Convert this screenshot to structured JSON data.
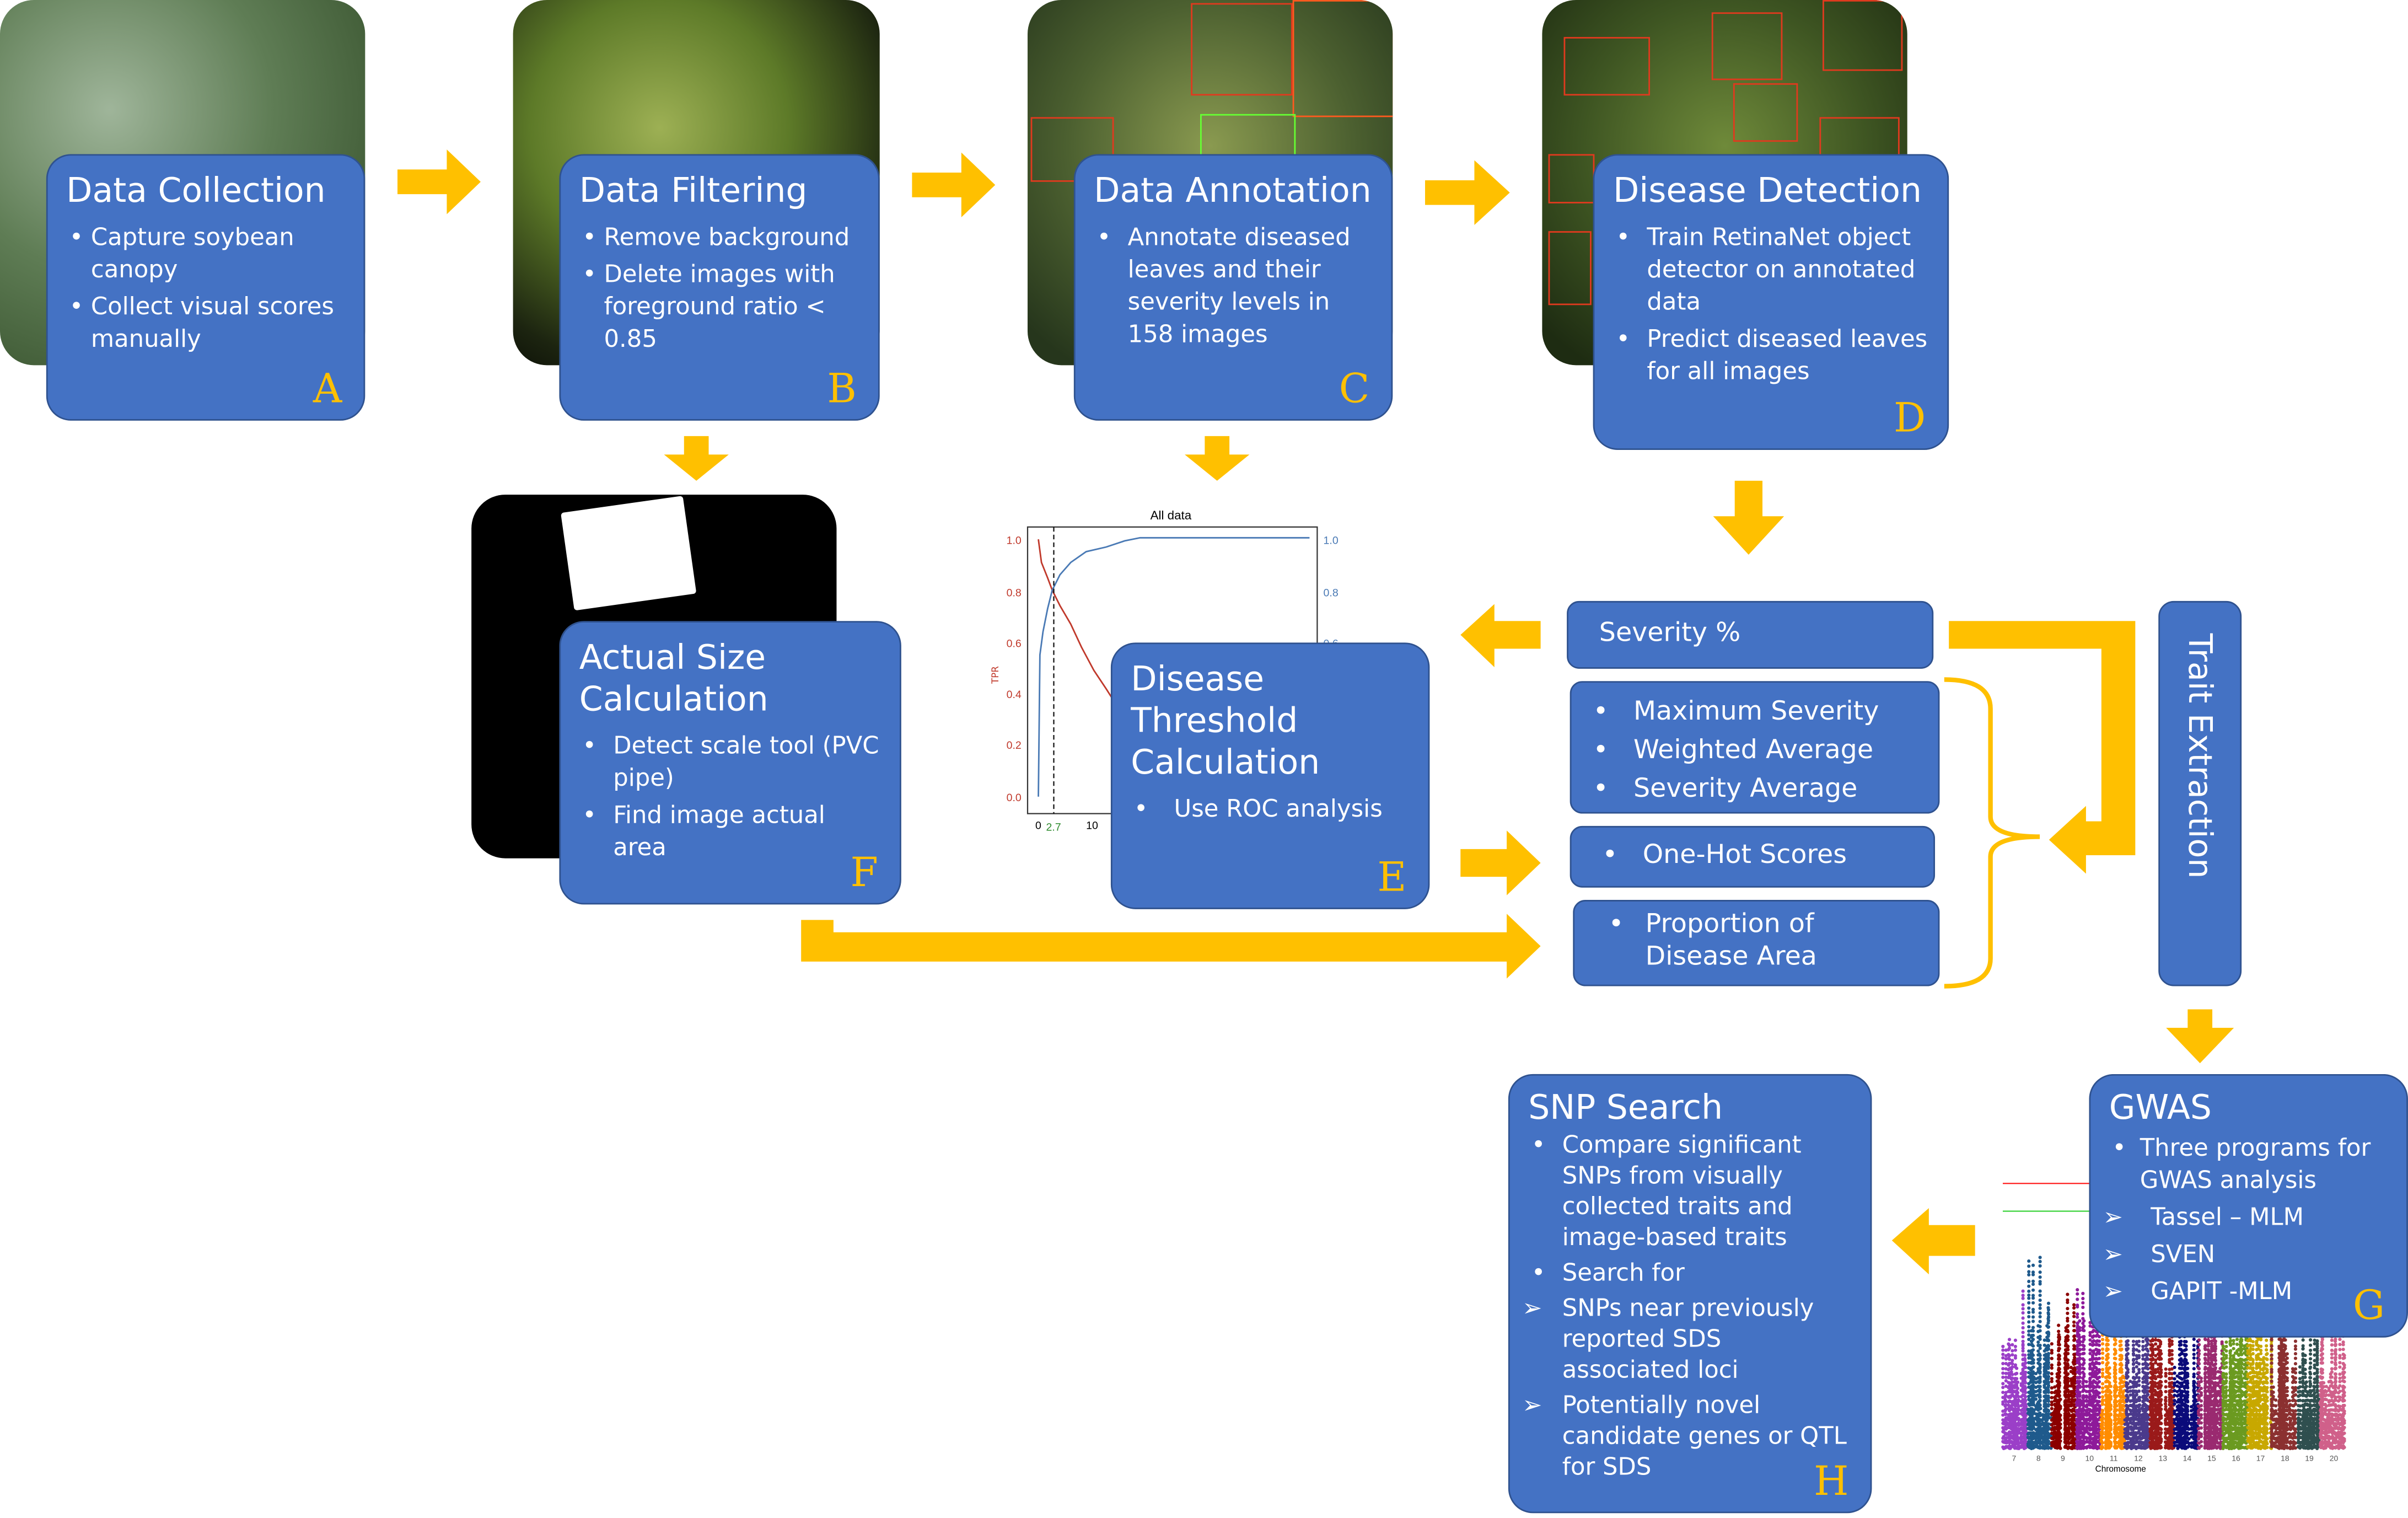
{
  "colors": {
    "box": "#4472c4",
    "arrow": "#ffc000",
    "letter": "#ffc000"
  },
  "steps": {
    "a": {
      "title": "Data Collection",
      "bullets": [
        "Capture soybean canopy",
        "Collect visual scores manually"
      ],
      "letter": "A"
    },
    "b": {
      "title": "Data Filtering",
      "bullets": [
        "Remove background",
        "Delete images with foreground ratio < 0.85"
      ],
      "letter": "B"
    },
    "c": {
      "title": "Data Annotation",
      "bullets": [
        "Annotate diseased leaves and their severity levels in 158 images"
      ],
      "letter": "C"
    },
    "d": {
      "title": "Disease Detection",
      "bullets": [
        "Train RetinaNet object detector on annotated data",
        "Predict diseased leaves for all images"
      ],
      "letter": "D"
    },
    "e": {
      "title": "Disease Threshold Calculation",
      "bullets": [
        "Use ROC analysis"
      ],
      "letter": "E"
    },
    "f": {
      "title": "Actual Size Calculation",
      "bullets": [
        "Detect scale tool (PVC pipe)",
        "Find image actual area"
      ],
      "letter": "F"
    },
    "g": {
      "title": "GWAS",
      "bullets": [
        "Three programs for GWAS analysis"
      ],
      "programs": [
        "Tassel – MLM",
        "SVEN",
        "GAPIT -MLM"
      ],
      "letter": "G"
    },
    "h": {
      "title": "SNP Search",
      "bullets": [
        "Compare significant SNPs from visually collected traits and image-based traits",
        "Search for"
      ],
      "sub": [
        "SNPs near previously reported SDS associated loci",
        "Potentially novel candidate genes or QTL for SDS"
      ],
      "letter": "H"
    }
  },
  "traits": {
    "severity": "Severity %",
    "list": [
      "Maximum Severity",
      "Weighted Average",
      "Severity Average"
    ],
    "onehot": "One-Hot Scores",
    "proportion": "Proportion of Disease Area",
    "extraction": "Trait Extraction"
  },
  "roc": {
    "title": "All data",
    "ylabel": "TPR",
    "left_ticks": [
      "1.0",
      "0.8",
      "0.6",
      "0.4",
      "0.2",
      "0.0"
    ],
    "right_ticks": [
      "1.0",
      "0.8",
      "0.6"
    ],
    "x_ticks": [
      "0",
      "10"
    ],
    "threshold": "2.7"
  },
  "manhattan": {
    "xlabel": "Chromosome",
    "chromosomes": [
      "7",
      "8",
      "9",
      "10",
      "11",
      "12",
      "13",
      "14",
      "15",
      "16",
      "17",
      "18",
      "19",
      "20"
    ],
    "colors": [
      "#9b3fc8",
      "#1f5a8c",
      "#8b0000",
      "#8e1a9a",
      "#ff8c00",
      "#4b3a8c",
      "#9a1a1a",
      "#0b0b7a",
      "#9a2a70",
      "#6b9a20",
      "#c8a800",
      "#8b3030",
      "#2f4f4f",
      "#d0608a"
    ]
  }
}
